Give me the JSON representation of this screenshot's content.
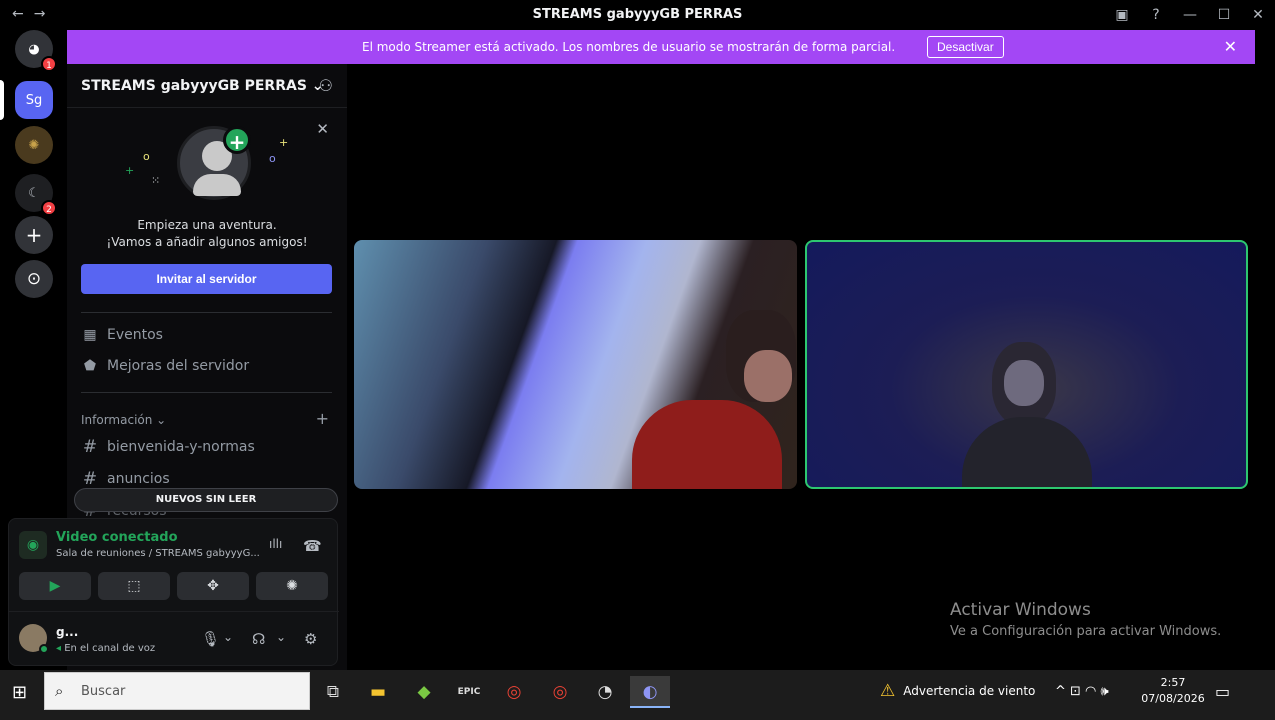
{
  "window": {
    "title": "STREAMS gabyyyGB PERRAS",
    "back_icon": "←",
    "forward_icon": "→",
    "inbox_icon": "▣",
    "help_icon": "?",
    "minimize": "—",
    "maximize": "☐",
    "close": "✕"
  },
  "banner": {
    "text": "El modo Streamer está activado. Los nombres de usuario se mostrarán de forma parcial.",
    "button": "Desactivar",
    "close": "✕",
    "color": "#a347f5"
  },
  "guilds": {
    "home_badge": "1",
    "server_abbrev": "Sg",
    "third_badge": "2",
    "add": "+",
    "explore": "⊙"
  },
  "sidebar": {
    "server_name": "STREAMS gabyyyGB PERRAS",
    "chevron": "⌄",
    "add_friend_icon": "⚇",
    "promo_close": "✕",
    "promo_line1": "Empieza una aventura.",
    "promo_line2": "¡Vamos a añadir algunos amigos!",
    "invite_button": "Invitar al servidor",
    "nav": [
      {
        "icon": "▦",
        "label": "Eventos"
      },
      {
        "icon": "⬟",
        "label": "Mejoras del servidor"
      }
    ],
    "category": "Información ⌄",
    "category_add": "+",
    "channels": [
      {
        "icon": "#",
        "label": "bienvenida-y-normas"
      },
      {
        "icon": "#",
        "label": "anuncios"
      },
      {
        "icon": "#",
        "label": "recursos"
      }
    ],
    "unread_pill": "NUEVOS SIN LEER"
  },
  "voice": {
    "status": "Video conectado",
    "channel": "Sala de reuniones / STREAMS gabyyyG...",
    "signal_icon": "◉",
    "noise_icon": "ıllı",
    "disconnect_icon": "☎",
    "buttons": [
      {
        "name": "camera",
        "icon": "▶"
      },
      {
        "name": "screen-share",
        "icon": "⬚"
      },
      {
        "name": "activities",
        "icon": "✥"
      },
      {
        "name": "soundboard",
        "icon": "✺"
      }
    ]
  },
  "user": {
    "name": "g...",
    "status": "En el canal de voz",
    "speaker_icon": "◂",
    "mic_icon": "🎙",
    "headset_icon": "☊",
    "caret_icon": "⌄",
    "settings_icon": "⚙"
  },
  "stage": {
    "watermark_title": "Activar Windows",
    "watermark_sub": "Ve a Configuración para activar Windows."
  },
  "taskbar": {
    "start_icon": "⊞",
    "search_icon": "⌕",
    "search_placeholder": "Buscar",
    "apps": [
      {
        "name": "task-view",
        "icon": "⧉"
      },
      {
        "name": "file-explorer",
        "icon": "▬"
      },
      {
        "name": "bluestacks",
        "icon": "◆"
      },
      {
        "name": "epic-games",
        "icon": "EPIC"
      },
      {
        "name": "chrome",
        "icon": "◎"
      },
      {
        "name": "chrome-2",
        "icon": "◎"
      },
      {
        "name": "speedometer",
        "icon": "◔"
      },
      {
        "name": "discord",
        "icon": "◐"
      }
    ],
    "warning_icon": "⚠",
    "warning_text": "Advertencia de viento",
    "tray": "^  ⊡  ◠  🕪",
    "time": "2:57",
    "date": "07/08/2026",
    "notification_icon": "▭"
  }
}
